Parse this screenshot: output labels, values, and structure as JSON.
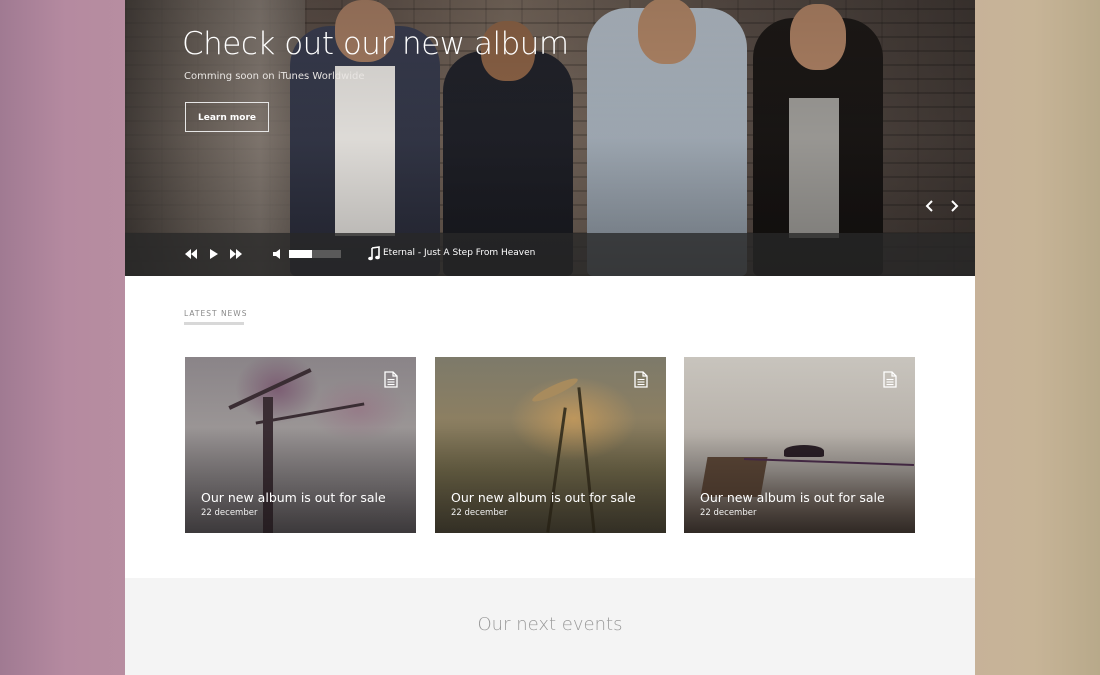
{
  "hero": {
    "title": "Check out our new album",
    "subtitle": "Comming soon on iTunes Worldwide",
    "button_label": "Learn more",
    "prev_icon": "chevron-left-icon",
    "next_icon": "chevron-right-icon"
  },
  "player": {
    "controls": [
      "rewind-icon",
      "play-icon",
      "fast-forward-icon",
      "volume-icon"
    ],
    "volume_level": 0.45,
    "track_icon": "music-note-icon",
    "track_name": "Eternal - Just A Step From Heaven"
  },
  "news": {
    "section_label": "LATEST NEWS",
    "items": [
      {
        "title": "Our new album is out for sale",
        "date": "22 december",
        "icon": "document-icon"
      },
      {
        "title": "Our new album is out for sale",
        "date": "22 december",
        "icon": "document-icon"
      },
      {
        "title": "Our new album is out for sale",
        "date": "22 december",
        "icon": "document-icon"
      }
    ]
  },
  "events": {
    "title": "Our next events"
  },
  "colors": {
    "page_bg": "#ffffff",
    "events_bg": "#f4f4f4",
    "player_bg": "#282828"
  }
}
